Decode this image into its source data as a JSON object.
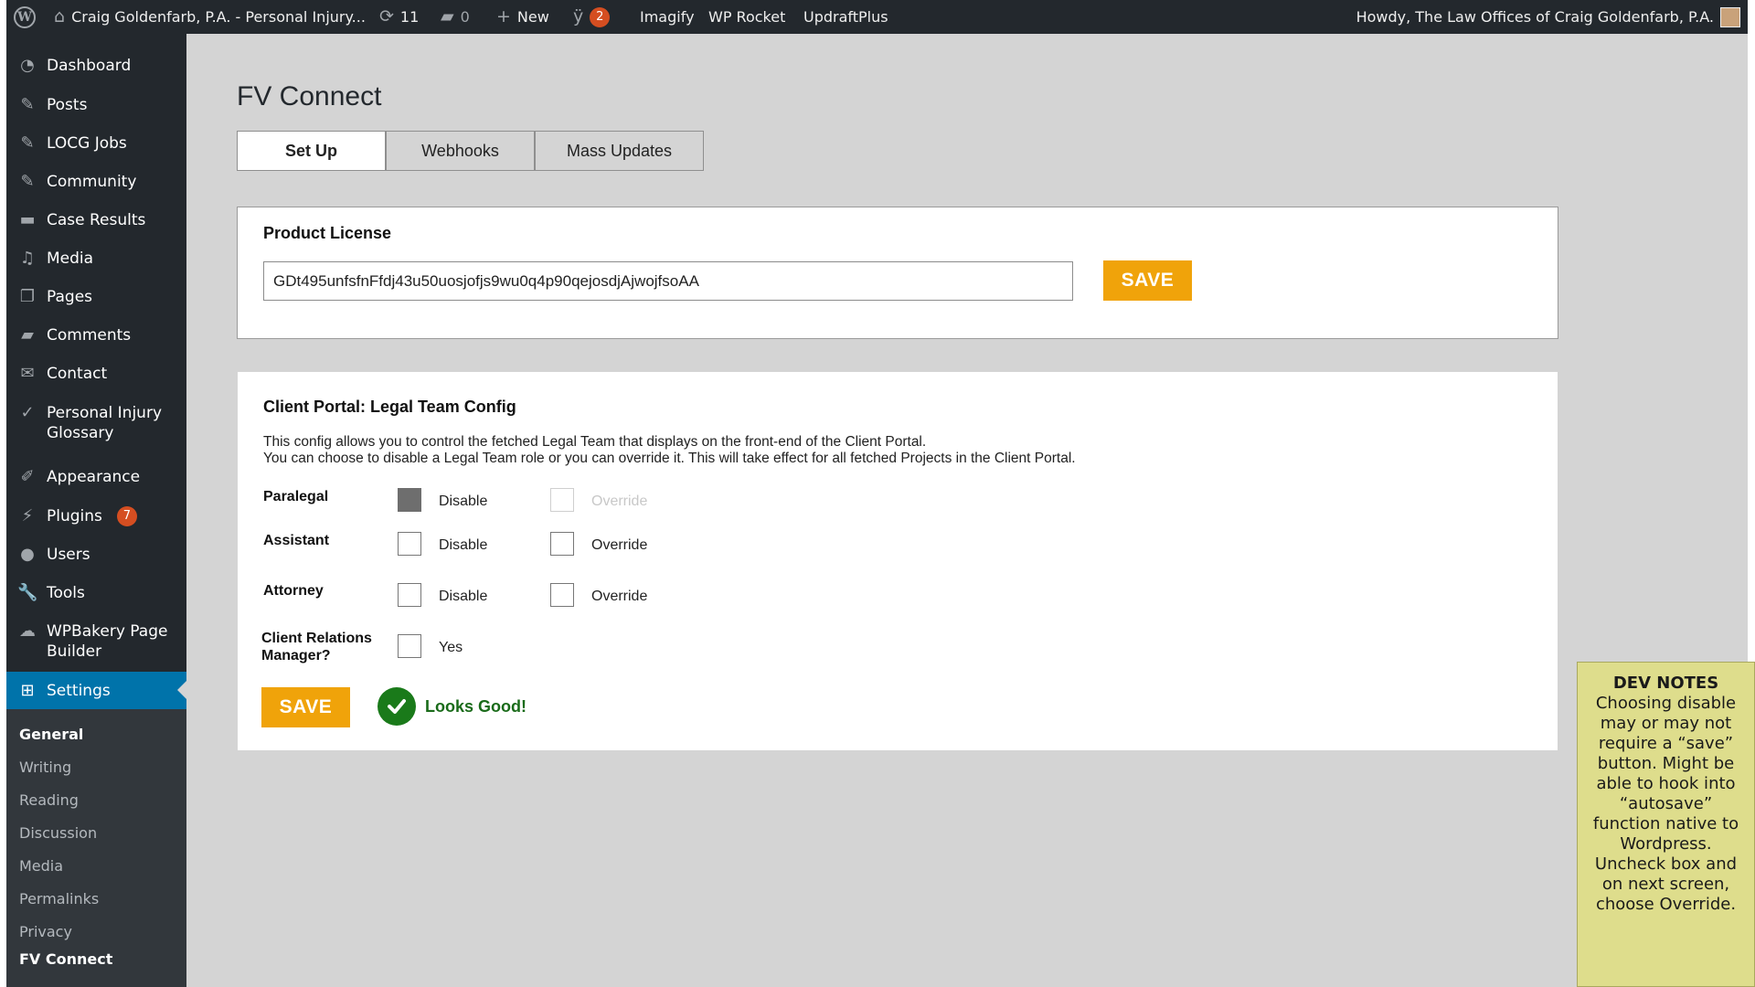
{
  "adminbar": {
    "site_name": "Craig Goldenfarb, P.A. - Personal Injury...",
    "updates_count": "11",
    "comments_count": "0",
    "new_label": "New",
    "yoast_badge": "2",
    "imagify_label": "Imagify",
    "wprocket_label": "WP Rocket",
    "updraft_label": "UpdraftPlus",
    "howdy_label": "Howdy, The Law Offices of Craig Goldenfarb, P.A."
  },
  "sidebar": {
    "items": [
      {
        "label": "Dashboard",
        "icon": "dashboard-icon"
      },
      {
        "label": "Posts",
        "icon": "pin-icon"
      },
      {
        "label": "LOCG Jobs",
        "icon": "pin-icon"
      },
      {
        "label": "Community",
        "icon": "pin-icon"
      },
      {
        "label": "Case Results",
        "icon": "folder-icon"
      },
      {
        "label": "Media",
        "icon": "media-icon"
      },
      {
        "label": "Pages",
        "icon": "pages-icon"
      },
      {
        "label": "Comments",
        "icon": "comment-icon"
      },
      {
        "label": "Contact",
        "icon": "mail-icon"
      },
      {
        "label": "Personal Injury Glossary",
        "icon": "spellcheck-icon"
      },
      {
        "label": "Appearance",
        "icon": "brush-icon"
      },
      {
        "label": "Plugins",
        "icon": "plugin-icon",
        "badge": "7"
      },
      {
        "label": "Users",
        "icon": "user-icon"
      },
      {
        "label": "Tools",
        "icon": "wrench-icon"
      },
      {
        "label": "WPBakery Page Builder",
        "icon": "cloud-icon"
      },
      {
        "label": "Settings",
        "icon": "settings-icon"
      }
    ],
    "submenu": [
      "General",
      "Writing",
      "Reading",
      "Discussion",
      "Media",
      "Permalinks",
      "Privacy",
      "FV Connect"
    ]
  },
  "page": {
    "title": "FV Connect",
    "tabs": [
      "Set Up",
      "Webhooks",
      "Mass Updates"
    ]
  },
  "license": {
    "title": "Product License",
    "value": "GDt495unfsfnFfdj43u50uosjofjs9wu0q4p90qejosdjAjwojfsoAA",
    "save_label": "SAVE"
  },
  "legal_team": {
    "title": "Client Portal: Legal Team Config",
    "desc_line1": "This config allows you to control the fetched Legal Team that displays on the front-end of the Client Portal.",
    "desc_line2": "You can choose to disable a Legal Team role or you can override it. This will take effect for all fetched Projects in the Client Portal.",
    "rows": [
      {
        "label": "Paralegal",
        "disable_label": "Disable",
        "override_label": "Override",
        "disable_checked": true,
        "override_enabled": false
      },
      {
        "label": "Assistant",
        "disable_label": "Disable",
        "override_label": "Override",
        "disable_checked": false,
        "override_enabled": true
      },
      {
        "label": "Attorney",
        "disable_label": "Disable",
        "override_label": "Override",
        "disable_checked": false,
        "override_enabled": true
      }
    ],
    "crm_label_1": "Client Relations",
    "crm_label_2": "Manager?",
    "crm_option": "Yes",
    "save_label": "SAVE",
    "status_text": "Looks Good!"
  },
  "dev_notes": {
    "title": "DEV NOTES",
    "body": "Choosing disable may or may not require a “save” button. Might be able to hook into “autosave” function native to Wordpress. Uncheck box and on next screen, choose Override."
  },
  "colors": {
    "accent_blue": "#0073aa",
    "save_orange": "#f0a30a",
    "success_green": "#1a7a1a",
    "note_yellow": "#dedd8c"
  }
}
